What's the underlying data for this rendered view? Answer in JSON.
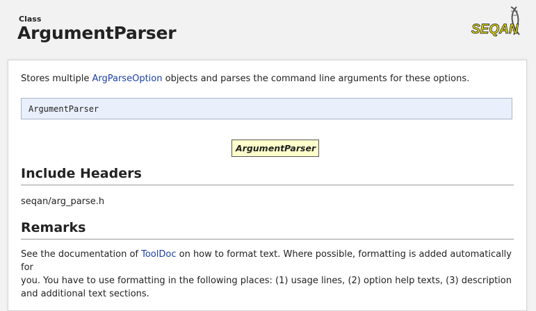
{
  "header": {
    "kind": "Class",
    "title": "ArgumentParser",
    "logo_text": "SEQAN"
  },
  "description": {
    "pre": "Stores multiple ",
    "link": "ArgParseOption",
    "post": " objects and parses the command line arguments for these options."
  },
  "signature": "ArgumentParser",
  "diagram": {
    "node": "ArgumentParser"
  },
  "include_headers": {
    "heading": "Include Headers",
    "path": "seqan/arg_parse.h"
  },
  "remarks": {
    "heading": "Remarks",
    "pre": "See the documentation of ",
    "link": "ToolDoc",
    "post": " on how to format text. Where possible, formatting is added automatically for",
    "line2": "you. You have to use formatting in the following places: (1) usage lines, (2) option help texts, (3) description",
    "line3": "and additional text sections."
  },
  "colors": {
    "link": "#1a3fa8",
    "signature_bg": "#eaf0fb",
    "diagram_bg": "#ffffcc",
    "logo_yellow": "#e8e000"
  }
}
